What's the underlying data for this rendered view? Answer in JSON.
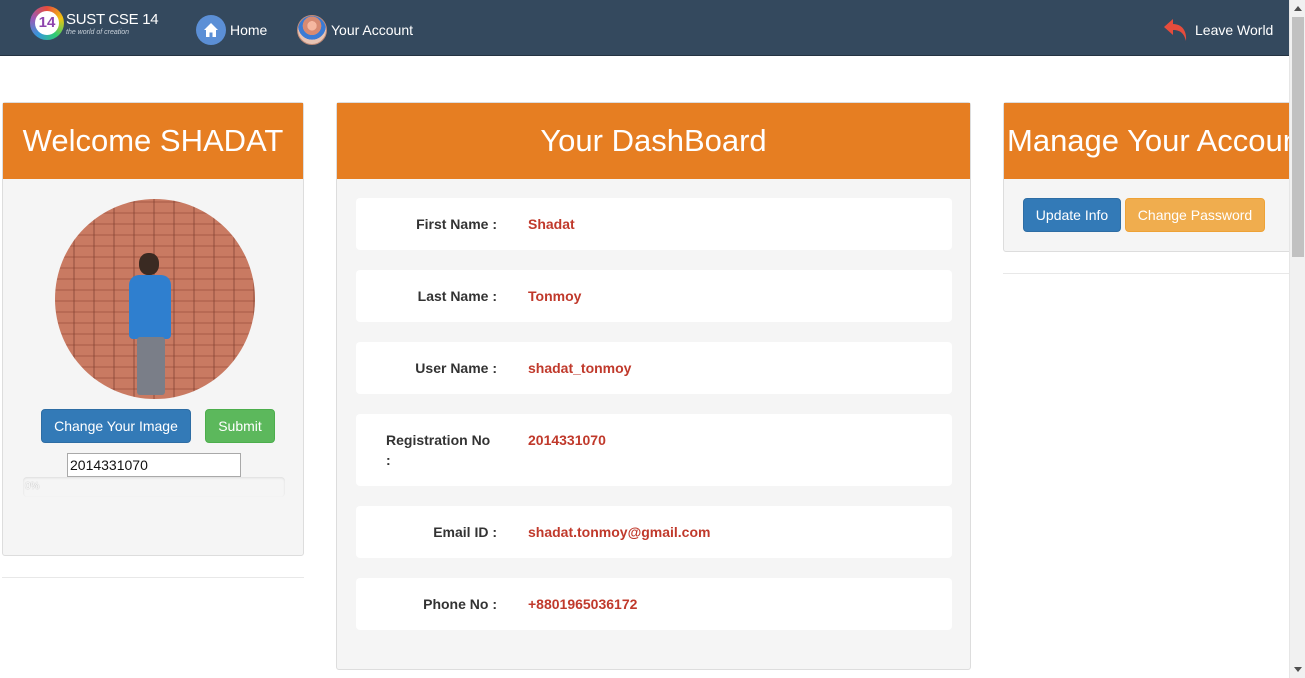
{
  "navbar": {
    "logo_badge": "14",
    "logo_title": "SUST CSE 14",
    "logo_subtitle": "the world of creation",
    "home_label": "Home",
    "account_label": "Your Account",
    "leave_label": "Leave World",
    "home_icon": "home-icon",
    "account_icon": "avatar-icon",
    "leave_icon": "undo-arrow-icon",
    "bg_color": "#34495e"
  },
  "left_panel": {
    "title": "Welcome SHADAT",
    "change_image_label": "Change Your Image",
    "submit_label": "Submit",
    "registration_input_value": "2014331070",
    "progress": {
      "percent": 0,
      "label": "0%"
    }
  },
  "center_panel": {
    "title": "Your DashBoard",
    "rows": [
      {
        "label": "First Name :",
        "value": "Shadat"
      },
      {
        "label": "Last Name :",
        "value": "Tonmoy"
      },
      {
        "label": "User Name :",
        "value": "shadat_tonmoy"
      },
      {
        "label": "Registration No :",
        "value": "2014331070"
      },
      {
        "label": "Email ID :",
        "value": "shadat.tonmoy@gmail.com"
      },
      {
        "label": "Phone No :",
        "value": "+8801965036172"
      }
    ]
  },
  "right_panel": {
    "title": "Manage Your Account",
    "update_label": "Update Info",
    "change_password_label": "Change Password"
  },
  "colors": {
    "accent": "#e67e22",
    "value_red": "#c0392b",
    "primary": "#337ab7",
    "success": "#5cb85c",
    "warning": "#f0ad4e"
  }
}
